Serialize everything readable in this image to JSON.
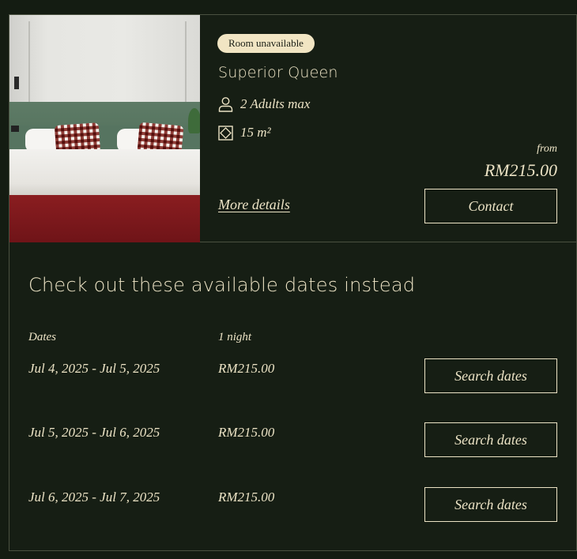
{
  "room": {
    "status_badge": "Room unavailable",
    "name": "Superior Queen",
    "capacity": "2 Adults max",
    "size": "15 m²",
    "price_prefix": "from",
    "price": "RM215.00",
    "more_details_label": "More details",
    "contact_label": "Contact",
    "icons": [
      "person-icon",
      "area-icon"
    ]
  },
  "alternatives": {
    "heading": "Check out these available dates instead",
    "col_dates": "Dates",
    "col_nights": "1 night",
    "rows": [
      {
        "dates": "Jul 4, 2025 - Jul 5, 2025",
        "price": "RM215.00",
        "button": "Search dates"
      },
      {
        "dates": "Jul 5, 2025 - Jul 6, 2025",
        "price": "RM215.00",
        "button": "Search dates"
      },
      {
        "dates": "Jul 6, 2025 - Jul 7, 2025",
        "price": "RM215.00",
        "button": "Search dates"
      }
    ]
  },
  "colors": {
    "background": "#141c12",
    "text": "#ece3c5",
    "badge_bg": "#f1e5c3",
    "border": "#4a5140"
  }
}
